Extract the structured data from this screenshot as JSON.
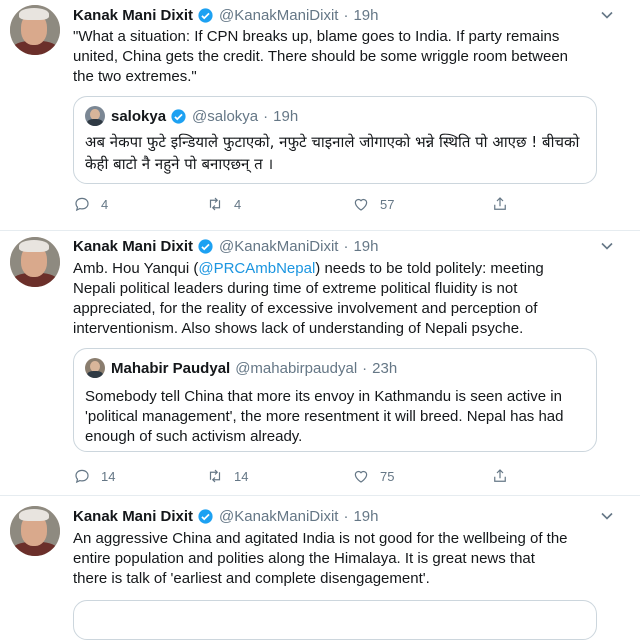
{
  "tweets": [
    {
      "name": "Kanak Mani Dixit",
      "handle": "@KanakManiDixit",
      "dot": "·",
      "time": "19h",
      "text": "\"What a situation: If CPN breaks up, blame goes to India. If party remains united, China gets the credit. There should be some wriggle room between the two extremes.\"",
      "quote": {
        "name": "salokya",
        "handle": "@salokya",
        "dot": "·",
        "time": "19h",
        "text": "अब नेकपा फुटे इन्डियाले फुटाएको,  नफुटे चाइनाले जोगाएको भन्ने स्थिति पो आएछ ! बीचको केही बाटो नै नहुने पो बनाएछन् त ।"
      },
      "replies": "4",
      "retweets": "4",
      "likes": "57"
    },
    {
      "name": "Kanak Mani Dixit",
      "handle": "@KanakManiDixit",
      "dot": "·",
      "time": "19h",
      "text_before": "Amb. Hou Yanqui (",
      "mention": "@PRCAmbNepal",
      "text_after": ") needs to be told politely: meeting Nepali political leaders during time of extreme political fluidity is not appreciated, for the reality of excessive involvement and perception of interventionism. Also shows lack of understanding of Nepali psyche.",
      "quote": {
        "name": "Mahabir Paudyal",
        "handle": "@mahabirpaudyal",
        "dot": "·",
        "time": "23h",
        "text": "Somebody tell China that more its envoy in Kathmandu is seen active in 'political management', the more resentment it will breed.  Nepal has had enough of such activism  already."
      },
      "replies": "14",
      "retweets": "14",
      "likes": "75"
    },
    {
      "name": "Kanak Mani Dixit",
      "handle": "@KanakManiDixit",
      "dot": "·",
      "time": "19h",
      "text": "An aggressive China and agitated India is not good for the wellbeing of the entire population and polities along the Himalaya. It is great news that there is talk of 'earliest and complete disengagement'."
    }
  ],
  "colors": {
    "verified": "#1da1f2",
    "link": "#1b95e0",
    "muted": "#657786",
    "border": "#ccd6dd"
  },
  "icons": [
    "caret-down-icon",
    "verified-badge-icon",
    "reply-icon",
    "retweet-icon",
    "like-icon",
    "share-icon"
  ]
}
